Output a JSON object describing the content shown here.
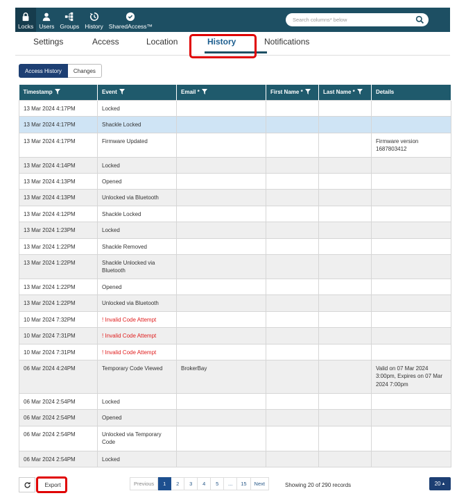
{
  "nav": {
    "items": [
      {
        "label": "Locks",
        "icon": "lock-icon"
      },
      {
        "label": "Users",
        "icon": "user-icon"
      },
      {
        "label": "Groups",
        "icon": "groups-icon"
      },
      {
        "label": "History",
        "icon": "history-icon"
      },
      {
        "label": "SharedAccess™",
        "icon": "shared-access-icon"
      }
    ],
    "search_placeholder": "Search columns* below"
  },
  "tabs": [
    "Settings",
    "Access",
    "Location",
    "History",
    "Notifications"
  ],
  "subtabs": [
    "Access History",
    "Changes"
  ],
  "table": {
    "headers": [
      "Timestamp",
      "Event",
      "Email *",
      "First Name *",
      "Last Name *",
      "Details"
    ],
    "rows": [
      {
        "ts": "13 Mar 2024 4:17PM",
        "event": "Locked",
        "email": "",
        "details": ""
      },
      {
        "ts": "13 Mar 2024 4:17PM",
        "event": "Shackle Locked",
        "email": "",
        "details": ""
      },
      {
        "ts": "13 Mar 2024 4:17PM",
        "event": "Firmware Updated",
        "email": "",
        "details": "Firmware version 1687803412"
      },
      {
        "ts": "13 Mar 2024 4:14PM",
        "event": "Locked",
        "email": "",
        "details": ""
      },
      {
        "ts": "13 Mar 2024 4:13PM",
        "event": "Opened",
        "email": "",
        "details": ""
      },
      {
        "ts": "13 Mar 2024 4:13PM",
        "event": "Unlocked via Bluetooth",
        "email": "",
        "details": ""
      },
      {
        "ts": "13 Mar 2024 4:12PM",
        "event": "Shackle Locked",
        "email": "",
        "details": ""
      },
      {
        "ts": "13 Mar 2024 1:23PM",
        "event": "Locked",
        "email": "",
        "details": ""
      },
      {
        "ts": "13 Mar 2024 1:22PM",
        "event": "Shackle Removed",
        "email": "",
        "details": ""
      },
      {
        "ts": "13 Mar 2024 1:22PM",
        "event": "Shackle Unlocked via Bluetooth",
        "email": "",
        "details": ""
      },
      {
        "ts": "13 Mar 2024 1:22PM",
        "event": "Opened",
        "email": "",
        "details": ""
      },
      {
        "ts": "13 Mar 2024 1:22PM",
        "event": "Unlocked via Bluetooth",
        "email": "",
        "details": ""
      },
      {
        "ts": "10 Mar 2024 7:32PM",
        "event": "! Invalid Code Attempt",
        "email": "",
        "details": ""
      },
      {
        "ts": "10 Mar 2024 7:31PM",
        "event": "! Invalid Code Attempt",
        "email": "",
        "details": ""
      },
      {
        "ts": "10 Mar 2024 7:31PM",
        "event": "! Invalid Code Attempt",
        "email": "",
        "details": ""
      },
      {
        "ts": "06 Mar 2024 4:24PM",
        "event": "Temporary Code Viewed",
        "email": "BrokerBay",
        "details": "Valid on 07 Mar 2024 3:00pm, Expires on 07 Mar 2024 7:00pm"
      },
      {
        "ts": "06 Mar 2024 2:54PM",
        "event": "Locked",
        "email": "",
        "details": ""
      },
      {
        "ts": "06 Mar 2024 2:54PM",
        "event": "Opened",
        "email": "",
        "details": ""
      },
      {
        "ts": "06 Mar 2024 2:54PM",
        "event": "Unlocked via Temporary Code",
        "email": "",
        "details": ""
      },
      {
        "ts": "06 Mar 2024 2:54PM",
        "event": "Locked",
        "email": "",
        "details": ""
      }
    ]
  },
  "footer": {
    "export_label": "Export",
    "pages": [
      "Previous",
      "1",
      "2",
      "3",
      "4",
      "5",
      "...",
      "15",
      "Next"
    ],
    "showing": "Showing 20 of 290 records",
    "page_size": "20"
  },
  "colors": {
    "nav_bg": "#1d4f63",
    "header_bg": "#1f5a6c",
    "highlight_row": "#cfe4f5",
    "alert_text": "#e02020",
    "annotation_red": "#e00000"
  }
}
